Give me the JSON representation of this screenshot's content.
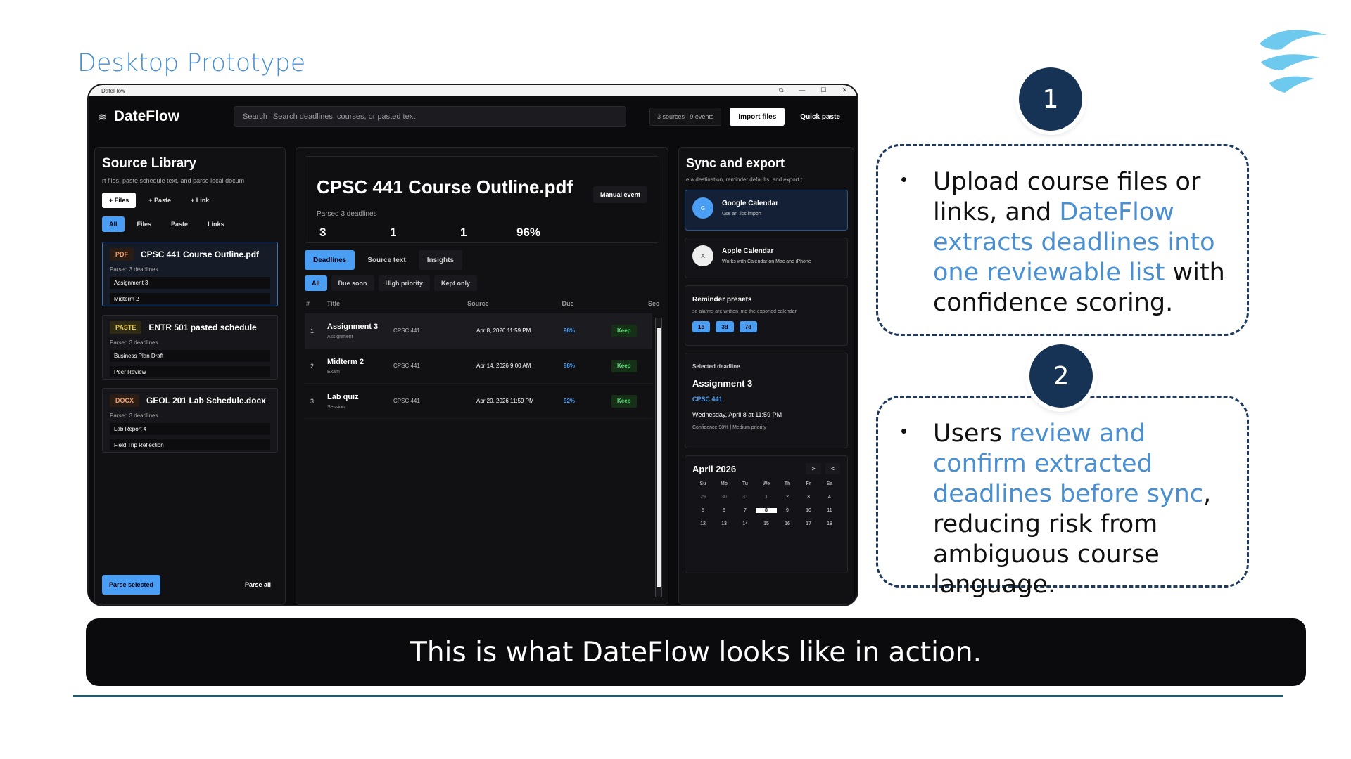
{
  "slide": {
    "title": "Desktop Prototype",
    "banner": "This is what DateFlow looks like in action."
  },
  "window": {
    "titlebar": "DateFlow"
  },
  "appbar": {
    "brand": "DateFlow",
    "search_label": "Search",
    "search_placeholder": "Search deadlines, courses, or pasted text",
    "status": "3 sources | 9 events",
    "import": "Import files",
    "quick_paste": "Quick paste"
  },
  "library": {
    "title": "Source Library",
    "subtitle": "rt files, paste schedule text, and parse local docum",
    "add_buttons": [
      "+ Files",
      "+ Paste",
      "+ Link"
    ],
    "filters": [
      "All",
      "Files",
      "Paste",
      "Links"
    ],
    "sources": [
      {
        "badge": "PDF",
        "name": "CPSC 441 Course Outline.pdf",
        "sub": "Parsed 3 deadlines",
        "items": [
          "Assignment 3",
          "Midterm 2"
        ]
      },
      {
        "badge": "PASTE",
        "name": "ENTR 501 pasted schedule",
        "sub": "Parsed 3 deadlines",
        "items": [
          "Business Plan Draft",
          "Peer Review"
        ]
      },
      {
        "badge": "DOCX",
        "name": "GEOL 201 Lab Schedule.docx",
        "sub": "Parsed 3 deadlines",
        "items": [
          "Lab Report 4",
          "Field Trip Reflection"
        ]
      }
    ],
    "parse_selected": "Parse selected",
    "parse_all": "Parse all"
  },
  "detail": {
    "title": "CPSC 441 Course Outline.pdf",
    "manual": "Manual event",
    "parsed": "Parsed 3 deadlines",
    "stats": [
      "3",
      "1",
      "1",
      "96%"
    ],
    "tabs": [
      "Deadlines",
      "Source text",
      "Insights"
    ],
    "filters": [
      "All",
      "Due soon",
      "High priority",
      "Kept only"
    ],
    "columns": [
      "#",
      "Title",
      "Source",
      "Due",
      "Sec"
    ],
    "rows": [
      {
        "num": "1",
        "title": "Assignment 3",
        "type": "Assignment",
        "source": "CPSC 441",
        "due": "Apr 8, 2026  11:59 PM",
        "conf": "98%",
        "action": "Keep"
      },
      {
        "num": "2",
        "title": "Midterm 2",
        "type": "Exam",
        "source": "CPSC 441",
        "due": "Apr 14, 2026  9:00 AM",
        "conf": "98%",
        "action": "Keep"
      },
      {
        "num": "3",
        "title": "Lab quiz",
        "type": "Session",
        "source": "CPSC 441",
        "due": "Apr 20, 2026  11:59 PM",
        "conf": "92%",
        "action": "Keep"
      }
    ]
  },
  "sync": {
    "title": "Sync and export",
    "subtitle": "e a destination, reminder defaults, and export t",
    "google": {
      "icon": "G",
      "name": "Google Calendar",
      "sub": "Use an .ics import"
    },
    "apple": {
      "icon": "A",
      "name": "Apple Calendar",
      "sub": "Works with Calendar on Mac and iPhone"
    },
    "reminder_title": "Reminder presets",
    "reminder_sub": "se alarms are written into the exported calendar",
    "reminders": [
      "1d",
      "3d",
      "7d"
    ],
    "selected_label": "Selected deadline",
    "selected_title": "Assignment 3",
    "selected_course": "CPSC 441",
    "selected_when": "Wednesday, April 8 at 11:59 PM",
    "selected_meta": "Confidence 98% | Medium priority",
    "calendar": {
      "month": "April 2026",
      "next": ">",
      "prev": "<",
      "weekdays": [
        "Su",
        "Mo",
        "Tu",
        "We",
        "Th",
        "Fr",
        "Sa"
      ],
      "days": [
        "29",
        "30",
        "31",
        "1",
        "2",
        "3",
        "4",
        "5",
        "6",
        "7",
        "8",
        "9",
        "10",
        "11",
        "12",
        "13",
        "14",
        "15",
        "16",
        "17",
        "18"
      ]
    }
  },
  "callouts": {
    "one": {
      "num": "1",
      "bullet": "•",
      "t1": "Upload course files or links, and ",
      "hl": "DateFlow extracts deadlines into one reviewable list",
      "t2": " with confidence scoring."
    },
    "two": {
      "num": "2",
      "bullet": "•",
      "t1": "Users ",
      "hl": "review and confirm extracted deadlines before sync",
      "t2": ", reducing risk from ambiguous course language."
    }
  },
  "colors": {
    "accent": "#4a9ff5",
    "heading_blue": "#4a8fd0",
    "navy": "#163356",
    "keep_green": "#5ce07a"
  }
}
